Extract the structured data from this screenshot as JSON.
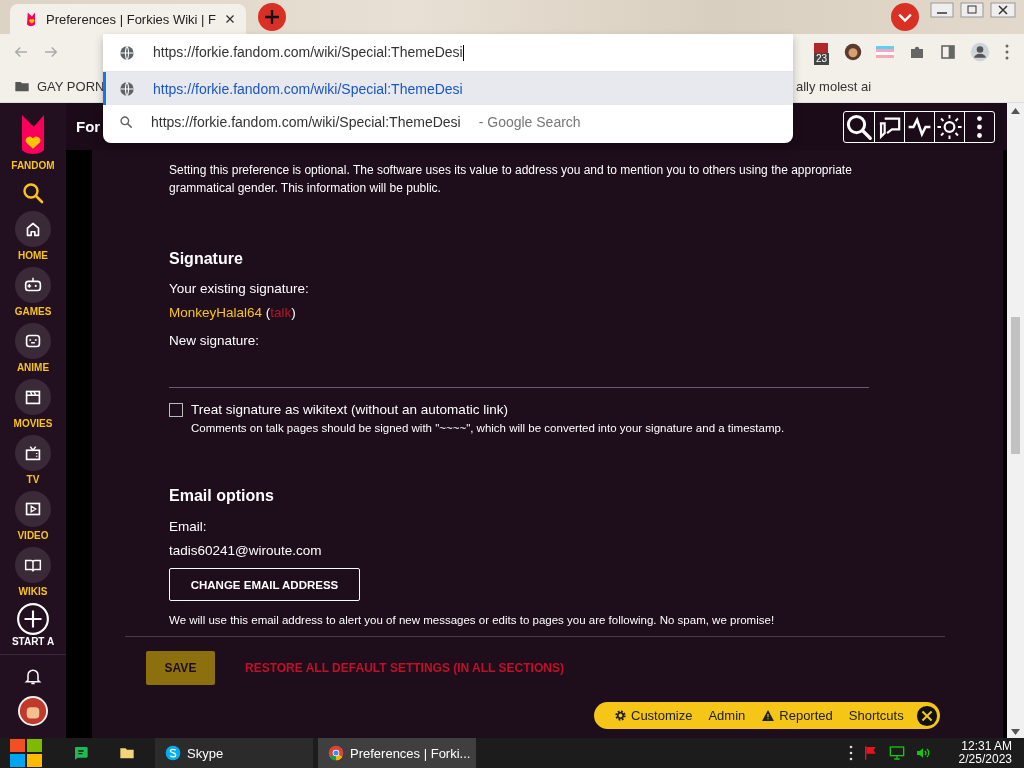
{
  "browser": {
    "tab_title": "Preferences | Forkies Wiki | F",
    "address": "https://forkie.fandom.com/wiki/Special:ThemeDesi",
    "extension_badge": "23",
    "suggestions": [
      {
        "kind": "url",
        "text": "https://forkie.fandom.com/wiki/Special:ThemeDesi",
        "selected": true
      },
      {
        "kind": "search",
        "text": "https://forkie.fandom.com/wiki/Special:ThemeDesi",
        "suffix": "- Google Search",
        "selected": false
      }
    ],
    "bookmarks": [
      {
        "label": "GAY PORN"
      },
      {
        "label": "ally molest ai"
      }
    ]
  },
  "sidebar": {
    "logo_label": "FANDOM",
    "items": [
      {
        "label": "HOME"
      },
      {
        "label": "GAMES"
      },
      {
        "label": "ANIME"
      },
      {
        "label": "MOVIES"
      },
      {
        "label": "TV"
      },
      {
        "label": "VIDEO"
      },
      {
        "label": "WIKIS"
      }
    ],
    "start_label": "START A"
  },
  "wiki_header": {
    "title": "For"
  },
  "content": {
    "gender_note": "Setting this preference is optional. The software uses its value to address you and to mention you to others using the appropriate grammatical gender. This information will be public.",
    "signature": {
      "heading": "Signature",
      "existing_label": "Your existing signature:",
      "user": "MonkeyHalal64",
      "wrap": [
        "(",
        ")"
      ],
      "talk": "talk",
      "new_label": "New signature:",
      "checkbox": {
        "label": "Treat signature as wikitext (without an automatic link)",
        "checked": false
      },
      "help": "Comments on talk pages should be signed with \"~~~~\", which will be converted into your signature and a timestamp."
    },
    "email": {
      "heading": "Email options",
      "label": "Email:",
      "address": "tadis60241@wiroute.com",
      "button": "CHANGE EMAIL ADDRESS",
      "note": "We will use this email address to alert you of new messages or edits to pages you are following. No spam, we promise!"
    },
    "actions": {
      "save": "SAVE",
      "restore": "RESTORE ALL DEFAULT SETTINGS (IN ALL SECTIONS)"
    }
  },
  "toolbar": {
    "items": [
      {
        "label": "Customize"
      },
      {
        "label": "Admin"
      },
      {
        "label": "Reported"
      },
      {
        "label": "Shortcuts"
      }
    ]
  },
  "taskbar": {
    "apps": [
      {
        "label": "Skype",
        "selected": false
      },
      {
        "label": "Preferences | Forki...",
        "selected": true
      }
    ],
    "time": "12:31 AM",
    "date": "2/25/2023"
  }
}
